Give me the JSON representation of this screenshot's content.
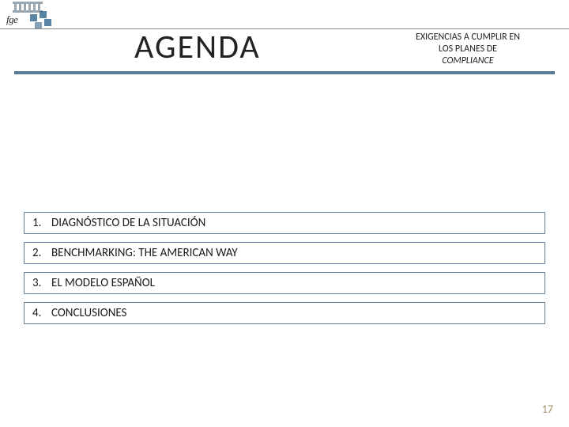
{
  "logo": {
    "text": "fge"
  },
  "title": "AGENDA",
  "subtitle": {
    "line1": "EXIGENCIAS A CUMPLIR EN",
    "line2": "LOS PLANES DE",
    "line3": "COMPLIANCE"
  },
  "agenda": {
    "items": [
      {
        "num": "1.",
        "text": "DIAGNÓSTICO DE LA SITUACIÓN"
      },
      {
        "num": "2.",
        "text": "BENCHMARKING: THE AMERICAN WAY"
      },
      {
        "num": "3.",
        "text": "EL MODELO ESPAÑOL"
      },
      {
        "num": "4.",
        "text": "CONCLUSIONES"
      }
    ]
  },
  "page_number": "17"
}
